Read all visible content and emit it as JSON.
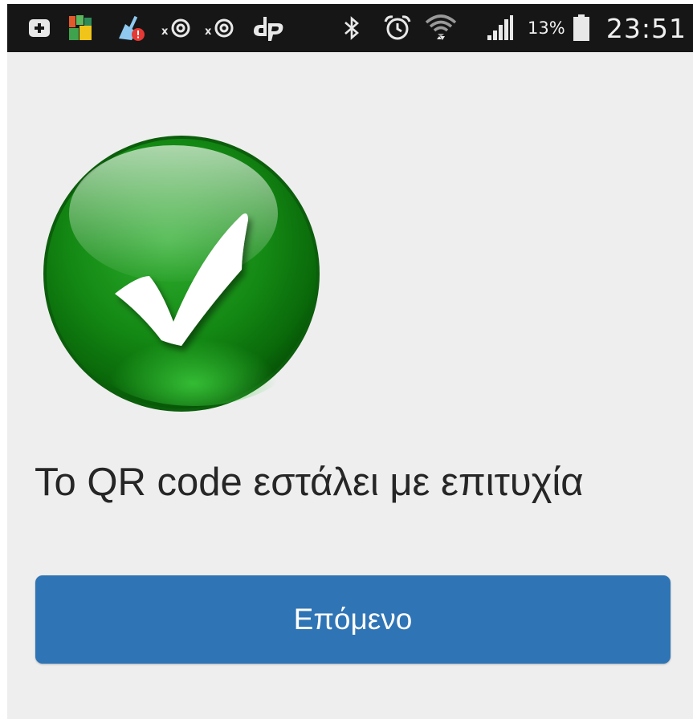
{
  "status_bar": {
    "time": "23:51",
    "battery_percent": "13%",
    "battery_level": 0.13,
    "icons": [
      "add-box-icon",
      "app-thumbnail-icon",
      "cleaner-alert-icon",
      "volume-icon",
      "volume-icon",
      "dp-app-icon",
      "bluetooth-icon",
      "alarm-clock-icon",
      "wifi-icon",
      "cellular-signal-icon",
      "battery-icon"
    ]
  },
  "main": {
    "status_icon": "success-check-icon",
    "message": "Το QR code εστάλει με επιτυχία",
    "next_button_label": "Επόμενο"
  },
  "colors": {
    "accent": "#2f74b5",
    "success": "#1e9a1e",
    "background": "#eeeeee",
    "status_bar": "#161616"
  }
}
